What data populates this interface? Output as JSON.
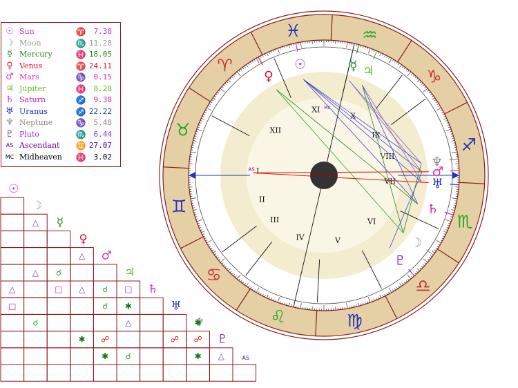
{
  "colors": {
    "frame": "#8b1a1a",
    "ring_fill": "#e5cfa5",
    "inner_fill": "#f3eccf",
    "center_fill": "#faf6e6"
  },
  "legend": [
    {
      "key": "sun",
      "glyph": "☉",
      "name": "Sun",
      "sign": "♈",
      "deg": "7.38",
      "color": "#cc33cc"
    },
    {
      "key": "moon",
      "glyph": "☽",
      "name": "Moon",
      "sign": "♏",
      "deg": "11.28",
      "color": "#999999"
    },
    {
      "key": "mercury",
      "glyph": "☿",
      "name": "Mercury",
      "sign": "♓",
      "deg": "18.05",
      "color": "#228b22"
    },
    {
      "key": "venus",
      "glyph": "♀",
      "name": "Venus",
      "sign": "♈",
      "deg": "24.11",
      "color": "#dd1133"
    },
    {
      "key": "mars",
      "glyph": "♂",
      "name": "Mars",
      "sign": "♑",
      "deg": "0.15",
      "color": "#dd33aa"
    },
    {
      "key": "jupiter",
      "glyph": "♃",
      "name": "Jupiter",
      "sign": "♓",
      "deg": "8.28",
      "color": "#66bb22"
    },
    {
      "key": "saturn",
      "glyph": "♄",
      "name": "Saturn",
      "sign": "♐",
      "deg": "9.38",
      "color": "#cc22aa"
    },
    {
      "key": "uranus",
      "glyph": "♅",
      "name": "Uranus",
      "sign": "♐",
      "deg": "22.22",
      "color": "#2233bb"
    },
    {
      "key": "neptune",
      "glyph": "♆",
      "name": "Neptune",
      "sign": "♑",
      "deg": "5.48",
      "color": "#888888"
    },
    {
      "key": "pluto",
      "glyph": "♇",
      "name": "Pluto",
      "sign": "♏",
      "deg": "6.44",
      "color": "#8833cc"
    },
    {
      "key": "ascendant",
      "glyph": "AS",
      "name": "Ascendant",
      "sign": "♊",
      "deg": "27.07",
      "color": "#660099"
    },
    {
      "key": "midheaven",
      "glyph": "MC",
      "name": "Midheaven",
      "sign": "♓",
      "deg": "3.02",
      "color": "#000000"
    }
  ],
  "grid_glyphs": [
    {
      "glyph": "☉",
      "color": "#cc33cc"
    },
    {
      "glyph": "☽",
      "color": "#999999"
    },
    {
      "glyph": "☿",
      "color": "#228b22"
    },
    {
      "glyph": "♀",
      "color": "#dd1133"
    },
    {
      "glyph": "♂",
      "color": "#dd33aa"
    },
    {
      "glyph": "♃",
      "color": "#66bb22"
    },
    {
      "glyph": "♄",
      "color": "#cc22aa"
    },
    {
      "glyph": "♅",
      "color": "#2233bb"
    },
    {
      "glyph": "♆",
      "color": "#888888"
    },
    {
      "glyph": "♇",
      "color": "#8833cc"
    },
    {
      "glyph": "AS",
      "color": "#660099"
    },
    {
      "glyph": "MC",
      "color": "#000000"
    }
  ],
  "aspect_symbols": {
    "trine": {
      "glyph": "△",
      "color": "#7733cc"
    },
    "sextile": {
      "glyph": "✱",
      "color": "#117711"
    },
    "square": {
      "glyph": "□",
      "color": "#cc22aa"
    },
    "opposition": {
      "glyph": "☍",
      "color": "#dd1111"
    },
    "conjunction": {
      "glyph": "☌",
      "color": "#22aa22"
    }
  },
  "aspects": [
    {
      "a": 2,
      "b": 1,
      "t": "trine"
    },
    {
      "a": 4,
      "b": 3,
      "t": "trine"
    },
    {
      "a": 5,
      "b": 1,
      "t": "trine"
    },
    {
      "a": 5,
      "b": 2,
      "t": "conjunction"
    },
    {
      "a": 6,
      "b": 0,
      "t": "trine"
    },
    {
      "a": 6,
      "b": 2,
      "t": "square"
    },
    {
      "a": 6,
      "b": 3,
      "t": "trine"
    },
    {
      "a": 6,
      "b": 4,
      "t": "conjunction"
    },
    {
      "a": 6,
      "b": 5,
      "t": "square"
    },
    {
      "a": 7,
      "b": 0,
      "t": "square"
    },
    {
      "a": 7,
      "b": 4,
      "t": "conjunction"
    },
    {
      "a": 7,
      "b": 5,
      "t": "sextile"
    },
    {
      "a": 8,
      "b": 1,
      "t": "conjunction"
    },
    {
      "a": 8,
      "b": 5,
      "t": "trine"
    },
    {
      "a": 8,
      "b": 8,
      "t": "sextile"
    },
    {
      "a": 9,
      "b": 3,
      "t": "sextile"
    },
    {
      "a": 9,
      "b": 4,
      "t": "opposition"
    },
    {
      "a": 9,
      "b": 7,
      "t": "opposition"
    },
    {
      "a": 9,
      "b": 8,
      "t": "opposition"
    },
    {
      "a": 10,
      "b": 4,
      "t": "sextile"
    },
    {
      "a": 10,
      "b": 5,
      "t": "conjunction"
    },
    {
      "a": 10,
      "b": 8,
      "t": "sextile"
    },
    {
      "a": 10,
      "b": 9,
      "t": "trine"
    }
  ],
  "wheel": {
    "zodiac": [
      {
        "glyph": "♓",
        "mid": 102,
        "color": "#2233bb"
      },
      {
        "glyph": "♒",
        "mid": 72,
        "color": "#22aa22"
      },
      {
        "glyph": "♑",
        "mid": 42,
        "color": "#cc3333"
      },
      {
        "glyph": "♐",
        "mid": 12,
        "color": "#2233bb"
      },
      {
        "glyph": "♏",
        "mid": -18,
        "color": "#22aa22"
      },
      {
        "glyph": "♎",
        "mid": -48,
        "color": "#cc3333"
      },
      {
        "glyph": "♍",
        "mid": -78,
        "color": "#2233bb"
      },
      {
        "glyph": "♌",
        "mid": -108,
        "color": "#22aa22"
      },
      {
        "glyph": "♋",
        "mid": -138,
        "color": "#cc3333"
      },
      {
        "glyph": "♊",
        "mid": -168,
        "color": "#2233bb"
      },
      {
        "glyph": "♉",
        "mid": 162,
        "color": "#22aa22"
      },
      {
        "glyph": "♈",
        "mid": 132,
        "color": "#cc3333"
      }
    ],
    "houses": [
      {
        "label": "I",
        "angle": 176
      },
      {
        "label": "II",
        "angle": -159
      },
      {
        "label": "III",
        "angle": -138
      },
      {
        "label": "IV",
        "angle": -111
      },
      {
        "label": "V",
        "angle": -78
      },
      {
        "label": "VI",
        "angle": -44
      },
      {
        "label": "VII",
        "angle": -5
      },
      {
        "label": "VIII",
        "angle": 17
      },
      {
        "label": "IX",
        "angle": 38
      },
      {
        "label": "X",
        "angle": 64
      },
      {
        "label": "XI",
        "angle": 97
      },
      {
        "label": "XII",
        "angle": 137
      }
    ],
    "cusps": [
      180,
      -143,
      -128,
      -93,
      -63,
      -25,
      0,
      37,
      52,
      77,
      113,
      152
    ],
    "angle_labels": {
      "asc": "AS",
      "mc": "MC"
    },
    "planets": [
      {
        "glyph": "☉",
        "angle": 102,
        "color": "#cc33cc"
      },
      {
        "glyph": "♀",
        "angle": 119,
        "color": "#dd1133"
      },
      {
        "glyph": "☿",
        "angle": 75,
        "color": "#228b22"
      },
      {
        "glyph": "♃",
        "angle": 67,
        "color": "#66bb22"
      },
      {
        "glyph": "♆",
        "angle": 7,
        "color": "#888888"
      },
      {
        "glyph": "♂",
        "angle": 2,
        "color": "#dd33aa"
      },
      {
        "glyph": "♅",
        "angle": -4,
        "color": "#2233bb"
      },
      {
        "glyph": "♄",
        "angle": -17,
        "color": "#cc22aa"
      },
      {
        "glyph": "☽",
        "angle": -36,
        "color": "#999999"
      },
      {
        "glyph": "♇",
        "angle": -48,
        "color": "#8833cc"
      }
    ]
  }
}
